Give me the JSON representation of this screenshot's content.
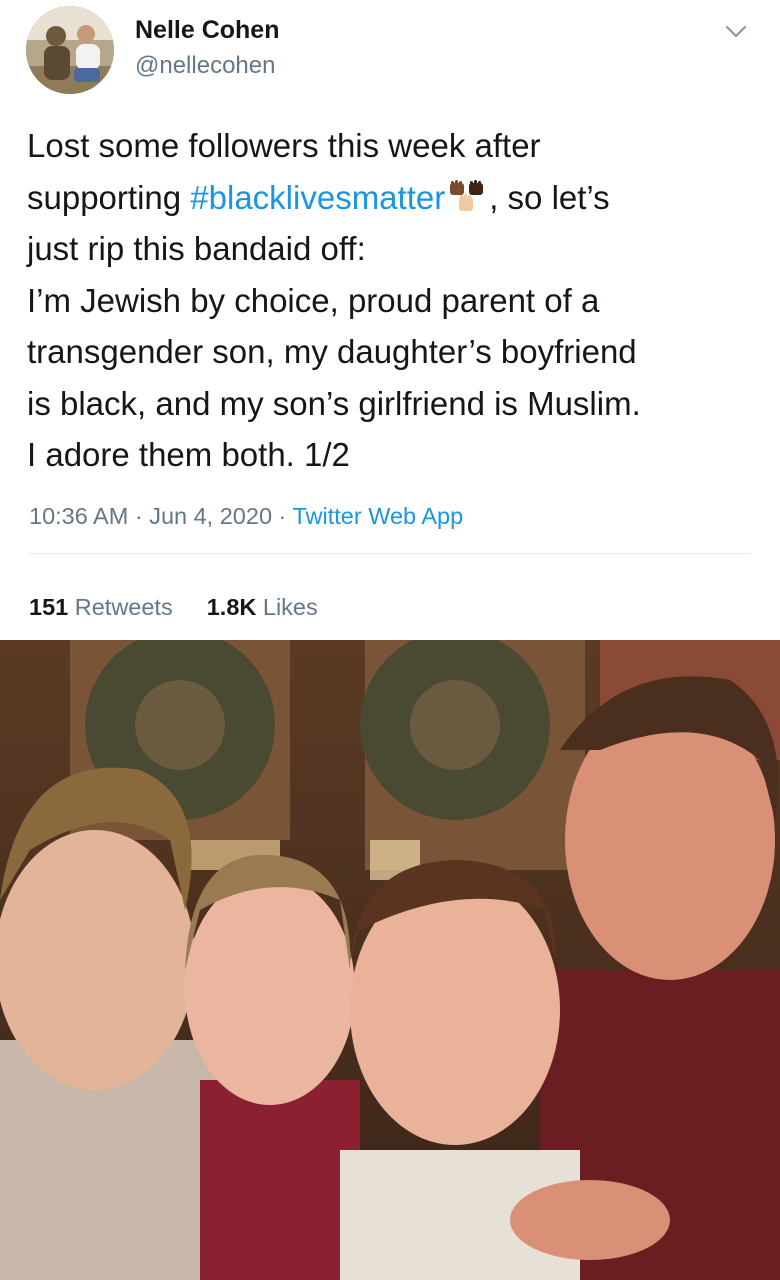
{
  "user": {
    "name": "Nelle Cohen",
    "handle": "@nellecohen",
    "avatar_icon": "avatar-photo-icon"
  },
  "tweet": {
    "line1": "Lost some followers this week after",
    "line2_before": "supporting ",
    "hashtag": "#blacklivesmatter",
    "emoji_icon": "raised-fists-emoji",
    "line2_after": ", so let’s",
    "line3": "just rip this bandaid off:",
    "line4": "I’m Jewish by choice, proud parent of a",
    "line5": "transgender son, my daughter’s boyfriend",
    "line6": "is black, and my son’s girlfriend is Muslim.",
    "line7": "I adore them both. 1/2"
  },
  "meta": {
    "time": "10:36 AM",
    "sep1": " · ",
    "date": "Jun 4, 2020",
    "sep2": " · ",
    "source": "Twitter Web App"
  },
  "stats": {
    "retweets_count": "151",
    "retweets_label": " Retweets",
    "likes_count": "1.8K",
    "likes_label": " Likes"
  },
  "colors": {
    "link": "#1b95e0",
    "secondary_text": "#657786",
    "primary_text": "#14171a",
    "divider": "#e6ecf0"
  }
}
